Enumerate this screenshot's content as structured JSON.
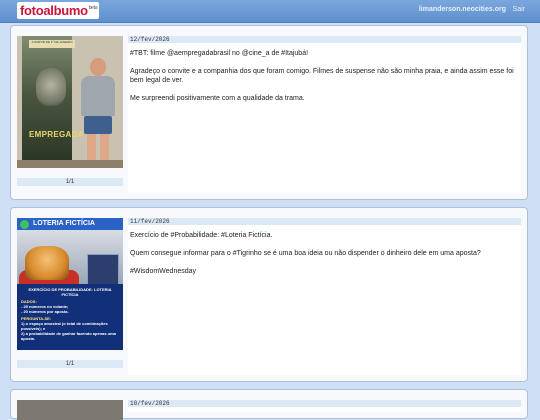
{
  "header": {
    "logo_text": "fotoalbumo",
    "logo_tag": "beta",
    "site_link": "limanderson.neocities.org",
    "logout_label": "Sair"
  },
  "colors": {
    "page_background": "#cfe0f5",
    "header": "#6b99d4",
    "accent_logo": "#c4163c",
    "strip": "#dbe8f6"
  },
  "posts": [
    {
      "date": "12/fev/2026",
      "counter": "1/1",
      "photo": {
        "poster_title": "EMPREGADA",
        "poster_top": "A PARTIR DE 1º DE JANEIRO"
      },
      "paragraphs": [
        "#TBT: filme @aempregadabrasil no @cine_a de #Itajubá!",
        "Agradeço o convite e a companhia dos que foram comigo. Filmes de suspense não são minha praia, e ainda assim esse foi bem legal de ver.",
        "Me surpreendi positivamente com a qualidade da trama."
      ]
    },
    {
      "date": "11/fev/2026",
      "counter": "1/1",
      "photo": {
        "banner": "LOTERIA FICTÍCIA",
        "info_title": "EXERCÍCIO DE PROBABILIDADE: LOTERIA FICTÍCIA",
        "label_data": "DADOS:",
        "data_lines": [
          "- 25 números no volante;",
          "- 20 números por aposta."
        ],
        "label_question": "PERGUNTA-SE:",
        "question_lines": [
          "1) o espaço amostral (o total de combinações possíveis); e",
          "2) a probabilidade de ganhar fazendo apenas uma aposta."
        ]
      },
      "paragraphs": [
        "Exercício de #Probabilidade: #Loteria Fictícia.",
        "Quem consegue informar para o #Tigrinho se é uma boa ideia ou não dispender o dinheiro dele em uma aposta?",
        "#WisdomWednesday"
      ]
    },
    {
      "date": "10/fev/2026"
    }
  ]
}
